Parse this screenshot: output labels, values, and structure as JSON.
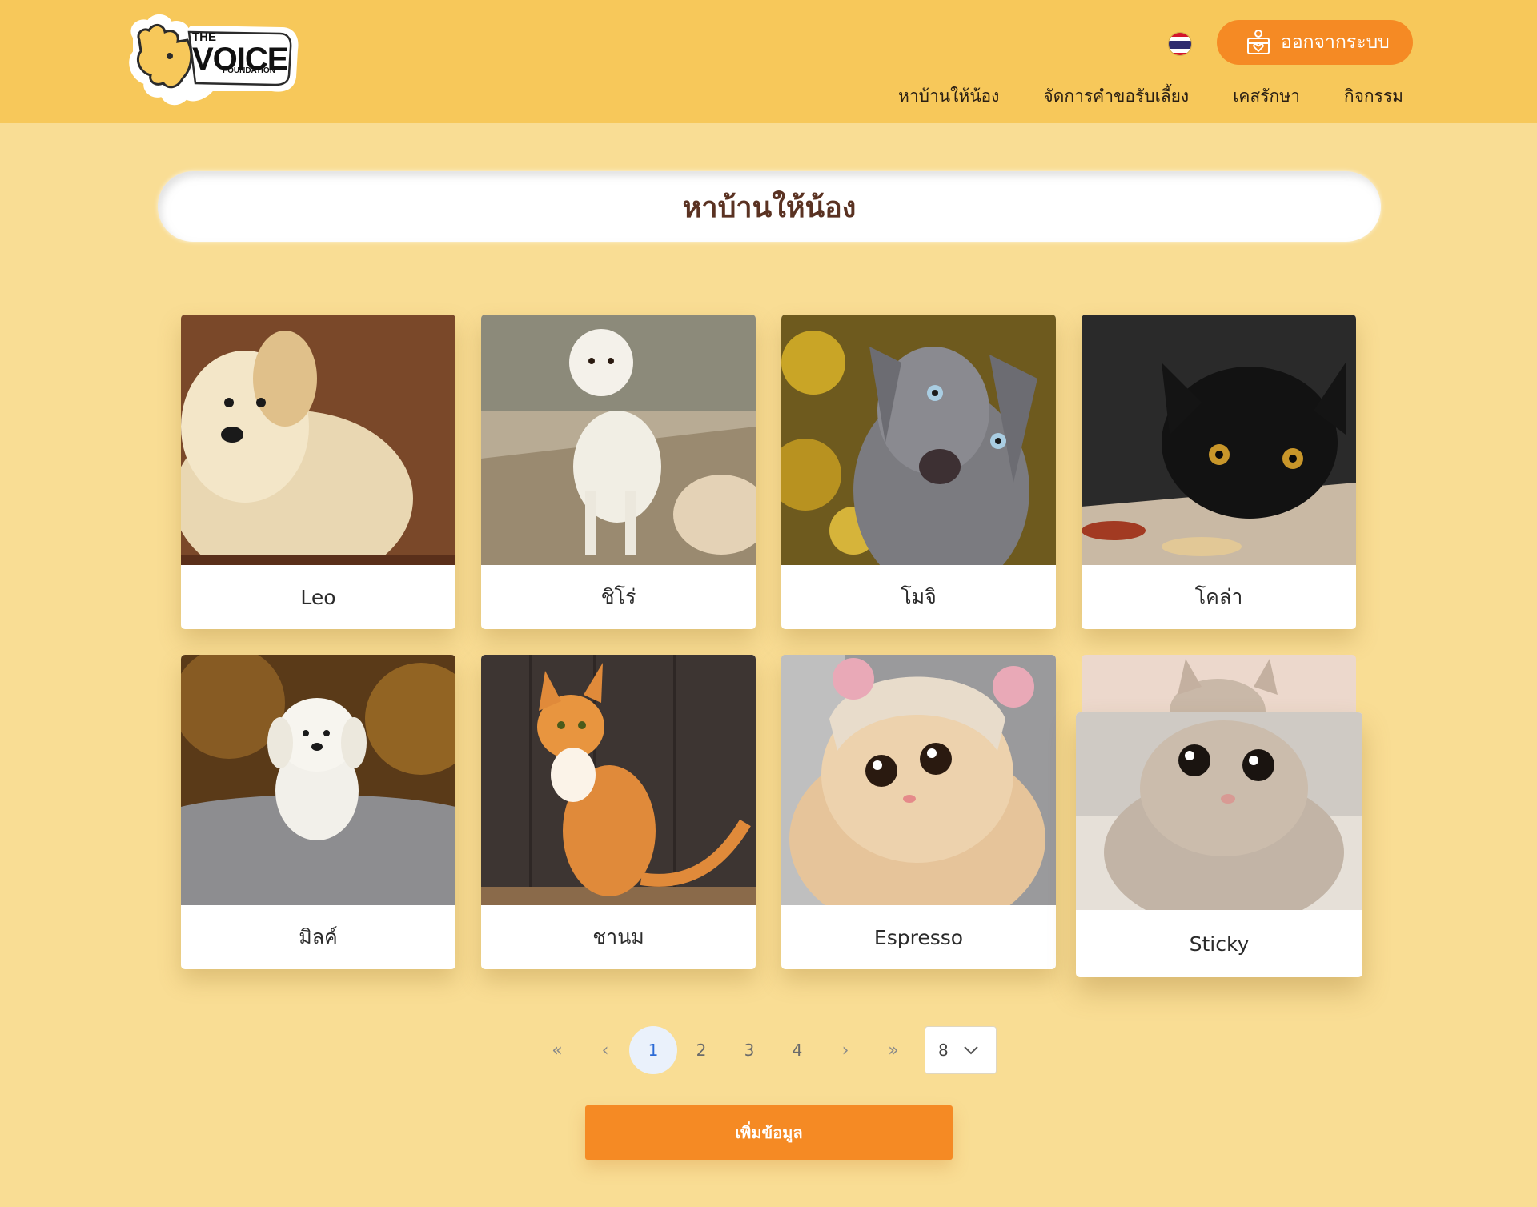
{
  "header": {
    "logo": {
      "line1": "THE",
      "line2": "VOICE",
      "line3": "FOUNDATION"
    },
    "language_flag_icon": "thai-flag-icon",
    "logout_label": "ออกจากระบบ",
    "nav": [
      {
        "label": "หาบ้านให้น้อง"
      },
      {
        "label": "จัดการคำขอรับเลี้ยง"
      },
      {
        "label": "เคสรักษา"
      },
      {
        "label": "กิจกรรม"
      }
    ]
  },
  "page_title": "หาบ้านให้น้อง",
  "pets": [
    {
      "name": "Leo"
    },
    {
      "name": "ชิโร่"
    },
    {
      "name": "โมจิ"
    },
    {
      "name": "โคล่า"
    },
    {
      "name": "มิลค์"
    },
    {
      "name": "ชานม"
    },
    {
      "name": "Espresso"
    },
    {
      "name": "Sticky"
    }
  ],
  "pagination": {
    "first": "«",
    "prev": "‹",
    "pages": [
      "1",
      "2",
      "3",
      "4"
    ],
    "current": "1",
    "next": "›",
    "last": "»",
    "page_size": "8"
  },
  "add_button_label": "เพิ่มข้อมูล",
  "colors": {
    "header_bg": "#f7c85a",
    "page_bg": "#f9dd94",
    "accent_orange": "#f58a24",
    "title_text": "#5a3222"
  }
}
